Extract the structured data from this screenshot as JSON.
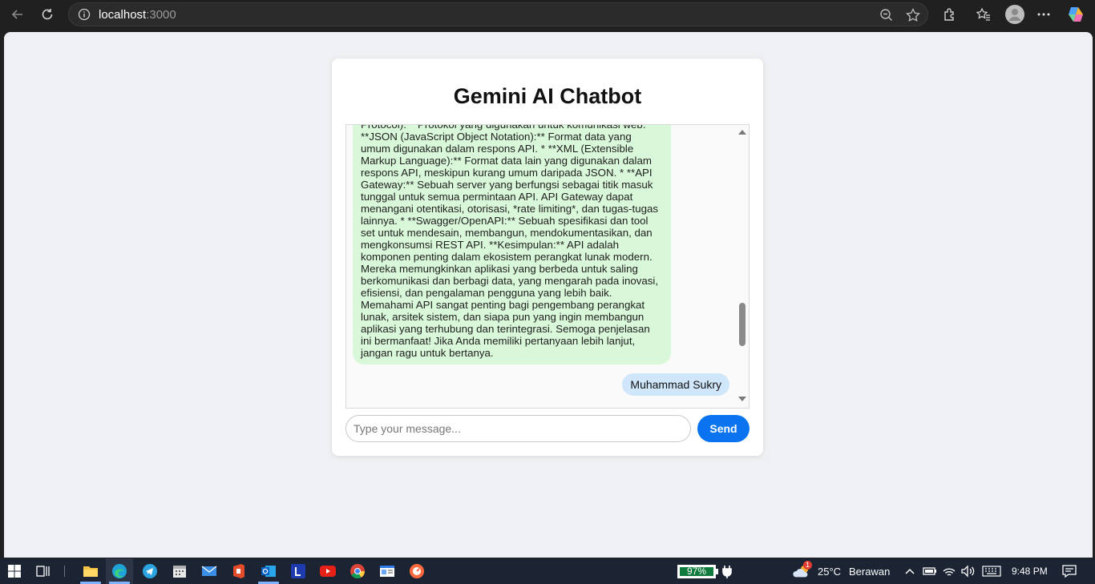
{
  "browser": {
    "url_host": "localhost",
    "url_port": ":3000"
  },
  "page": {
    "title": "Gemini AI Chatbot",
    "messages": {
      "bot_lines": [
        "Protocol):** Protokol yang digunakan untuk komunikasi web. *",
        "**JSON (JavaScript Object Notation):** Format data yang",
        "umum digunakan dalam respons API. * **XML (Extensible",
        "Markup Language):** Format data lain yang digunakan dalam",
        "respons API, meskipun kurang umum daripada JSON. * **API",
        "Gateway:** Sebuah server yang berfungsi sebagai titik masuk",
        "tunggal untuk semua permintaan API. API Gateway dapat",
        "menangani otentikasi, otorisasi, *rate limiting*, dan tugas-tugas",
        "lainnya. * **Swagger/OpenAPI:** Sebuah spesifikasi dan tool",
        "set untuk mendesain, membangun, mendokumentasikan, dan",
        "mengkonsumsi REST API. **Kesimpulan:** API adalah",
        "komponen penting dalam ekosistem perangkat lunak modern.",
        "Mereka memungkinkan aplikasi yang berbeda untuk saling",
        "berkomunikasi dan berbagi data, yang mengarah pada inovasi,",
        "efisiensi, dan pengalaman pengguna yang lebih baik.",
        "Memahami API sangat penting bagi pengembang perangkat",
        "lunak, arsitek sistem, dan siapa pun yang ingin membangun",
        "aplikasi yang terhubung dan terintegrasi. Semoga penjelasan",
        "ini bermanfaat! Jika Anda memiliki pertanyaan lebih lanjut,",
        "jangan ragu untuk bertanya."
      ],
      "user_message": "Muhammad Sukry"
    },
    "input": {
      "placeholder": "Type your message...",
      "value": ""
    },
    "send_label": "Send",
    "colors": {
      "bot_bubble": "#d9f7d9",
      "user_bubble": "#cfe6fb",
      "send_button": "#0a74f0"
    }
  },
  "taskbar": {
    "battery": "97%",
    "weather_badge": "1",
    "temperature": "25°C",
    "weather_text": "Berawan",
    "time": "9:48 PM",
    "apps": [
      "start",
      "task-view",
      "file-explorer",
      "edge",
      "telegram",
      "calendar",
      "mail",
      "wps",
      "outlook",
      "l-app",
      "youtube",
      "chrome",
      "news",
      "app-orange"
    ]
  }
}
